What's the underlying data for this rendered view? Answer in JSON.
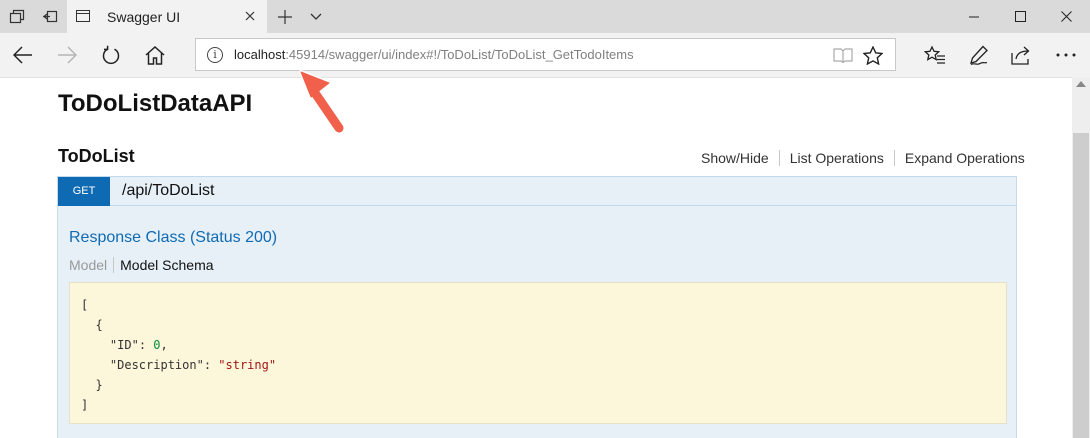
{
  "browser": {
    "tab_title": "Swagger UI",
    "url_host": "localhost",
    "url_rest": ":45914/swagger/ui/index#!/ToDoList/ToDoList_GetTodoItems",
    "icons": {
      "tab_preview": "tab-preview-icon",
      "set_aside": "set-aside-tabs-icon",
      "favicon": "page-favicon-icon",
      "new_tab": "plus-icon",
      "tab_list": "chevron-down-icon",
      "minimize": "minimize-icon",
      "maximize": "maximize-icon",
      "close": "close-icon",
      "back": "back-arrow-icon",
      "forward": "forward-arrow-icon",
      "refresh": "refresh-icon",
      "home": "home-icon",
      "site_info": "info-icon",
      "reading_view": "reading-view-icon",
      "favorite": "star-icon",
      "favorites_hub": "favorites-hub-icon",
      "web_note": "pen-icon",
      "share": "share-icon",
      "more": "more-icon"
    }
  },
  "swagger": {
    "api_title": "ToDoListDataAPI",
    "resource": {
      "name": "ToDoList",
      "links": [
        "Show/Hide",
        "List Operations",
        "Expand Operations"
      ]
    },
    "operation": {
      "method": "GET",
      "path": "/api/ToDoList",
      "response_class": "Response Class (Status 200)",
      "model_tab": "Model",
      "schema_tab": "Model Schema",
      "schema": {
        "open_bracket": "[",
        "open_brace": "{",
        "id_key": "\"ID\"",
        "id_value": "0",
        "desc_key": "\"Description\"",
        "desc_value": "\"string\"",
        "close_brace": "}",
        "close_bracket": "]"
      }
    }
  },
  "colors": {
    "get_badge": "#0f6ab4",
    "operation_bg": "#e7f0f7",
    "snippet_bg": "#fcf6db",
    "annotation_arrow": "#f0604a"
  }
}
